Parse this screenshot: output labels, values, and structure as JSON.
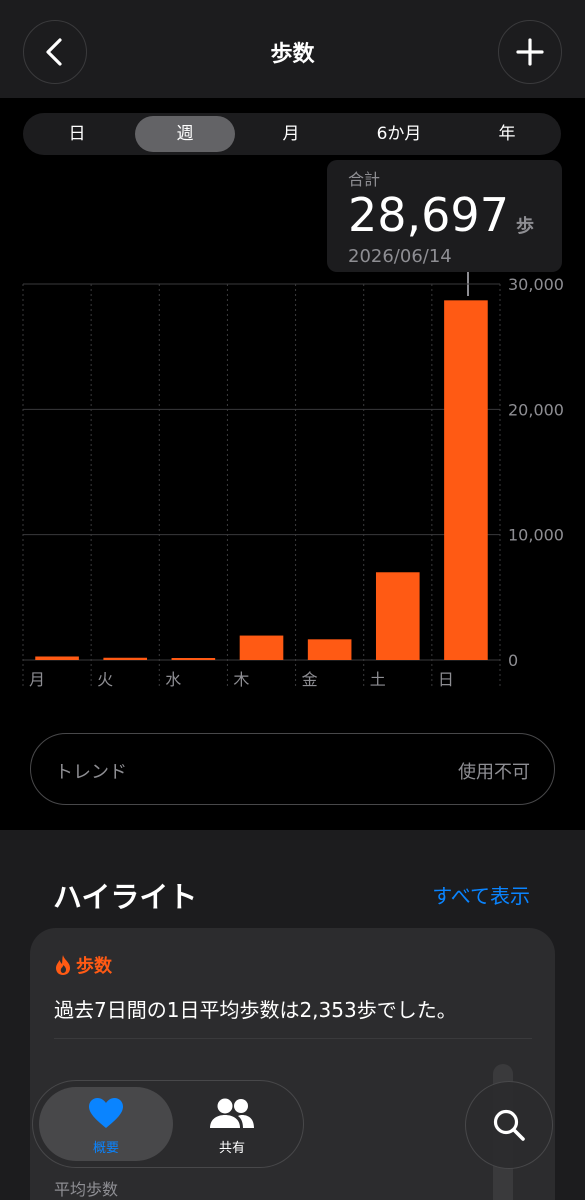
{
  "header": {
    "title": "歩数"
  },
  "segments": [
    {
      "label": "日",
      "active": false
    },
    {
      "label": "週",
      "active": true
    },
    {
      "label": "月",
      "active": false
    },
    {
      "label": "6か月",
      "active": false
    },
    {
      "label": "年",
      "active": false
    }
  ],
  "tooltip": {
    "label": "合計",
    "value": "28,697",
    "unit": "歩",
    "date": "2026/06/14"
  },
  "colors": {
    "accent": "#ff5a14",
    "link": "#0a84ff",
    "secondary_text": "#8e8e93"
  },
  "chart_data": {
    "type": "bar",
    "categories": [
      "月",
      "火",
      "水",
      "木",
      "金",
      "土",
      "日"
    ],
    "values": [
      280,
      180,
      90,
      1950,
      1650,
      7000,
      28697
    ],
    "ylim": [
      0,
      30000
    ],
    "y_ticks": [
      "0",
      "10,000",
      "20,000",
      "30,000"
    ],
    "y_tick_values": [
      0,
      10000,
      20000,
      30000
    ],
    "grid": true
  },
  "trend": {
    "label": "トレンド",
    "value": "使用不可"
  },
  "highlights": {
    "title": "ハイライト",
    "show_all": "すべて表示",
    "card": {
      "category": "歩数",
      "text": "過去7日間の1日平均歩数は2,353歩でした。",
      "sub_label": "平均歩数"
    }
  },
  "tabs": [
    {
      "label": "概要",
      "icon": "heart-icon",
      "active": true
    },
    {
      "label": "共有",
      "icon": "people-icon",
      "active": false
    }
  ],
  "icons": {
    "back": "chevron-left-icon",
    "add": "plus-icon",
    "search": "search-icon",
    "flame": "flame-icon"
  }
}
